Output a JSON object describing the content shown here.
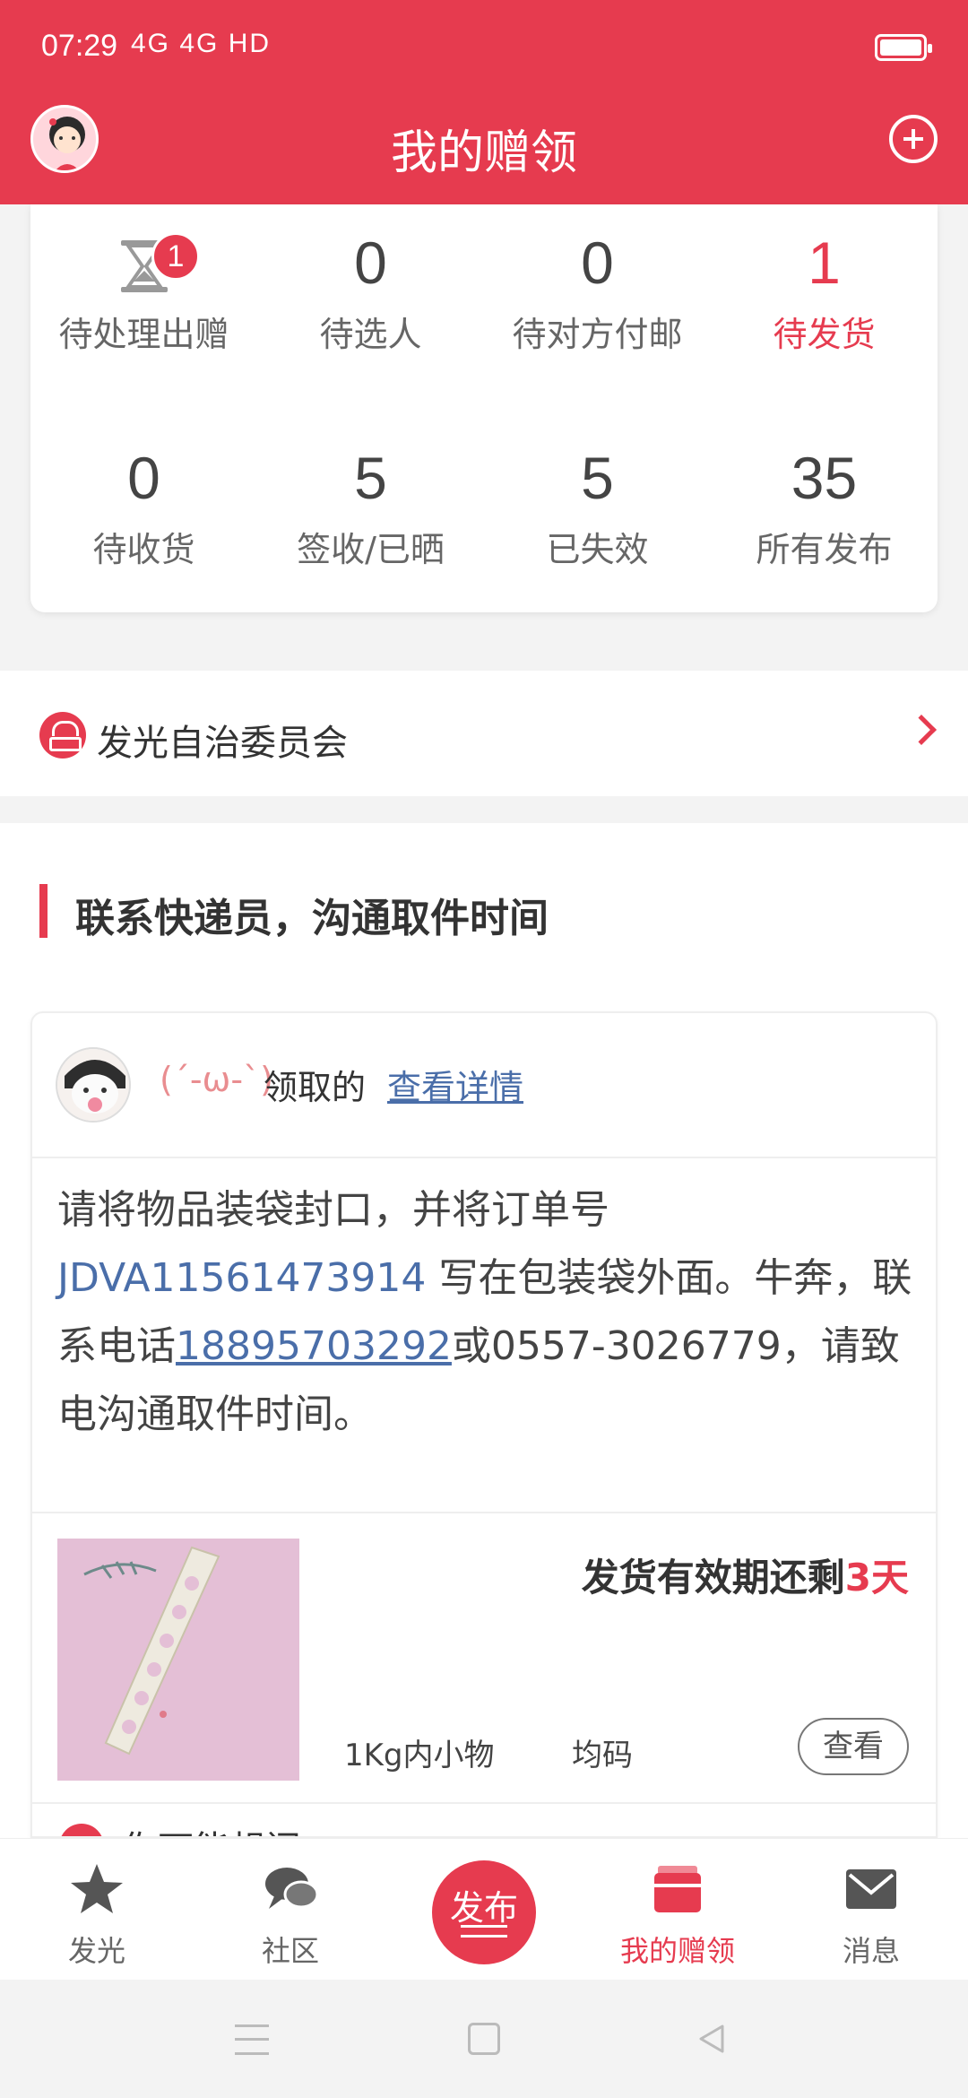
{
  "status_bar": {
    "time": "07:29",
    "network": "4G 4G HD"
  },
  "header": {
    "title": "我的赠领"
  },
  "stats": [
    {
      "value": "",
      "label": "待处理出赠",
      "badge": "1",
      "icon": "hourglass-icon"
    },
    {
      "value": "0",
      "label": "待选人"
    },
    {
      "value": "0",
      "label": "待对方付邮"
    },
    {
      "value": "1",
      "label": "待发货",
      "active": true
    },
    {
      "value": "0",
      "label": "待收货"
    },
    {
      "value": "5",
      "label": "签收/已晒"
    },
    {
      "value": "5",
      "label": "已失效"
    },
    {
      "value": "35",
      "label": "所有发布"
    }
  ],
  "committee": {
    "label": "发光自治委员会"
  },
  "section": {
    "title": "联系快递员，沟通取件时间"
  },
  "order": {
    "user_name": "(´-ω-`)",
    "received_text": "领取的",
    "detail_link": "查看详情",
    "instruction_prefix": "请将物品装袋封口，并将订单号 ",
    "order_number": "JDVA11561473914",
    "instruction_mid": " 写在包装袋外面。牛奔，联系电话",
    "phone": "18895703292",
    "instruction_suffix": "或0557-3026779，请致电沟通取件时间。",
    "validity_prefix": "发货有效期还剩",
    "validity_days": "3天",
    "size": "1Kg内小物",
    "code": "均码",
    "view_label": "查看",
    "partial_text": "你可能想问"
  },
  "tabbar": {
    "tabs": [
      {
        "label": "发光",
        "icon": "star-icon"
      },
      {
        "label": "社区",
        "icon": "chat-icon"
      },
      {
        "label": "发布",
        "icon": "publish-icon"
      },
      {
        "label": "我的赠领",
        "icon": "gift-box-icon",
        "active": true
      },
      {
        "label": "消息",
        "icon": "mail-icon"
      }
    ]
  },
  "colors": {
    "accent": "#e63b4f",
    "link": "#4a6ea9"
  }
}
